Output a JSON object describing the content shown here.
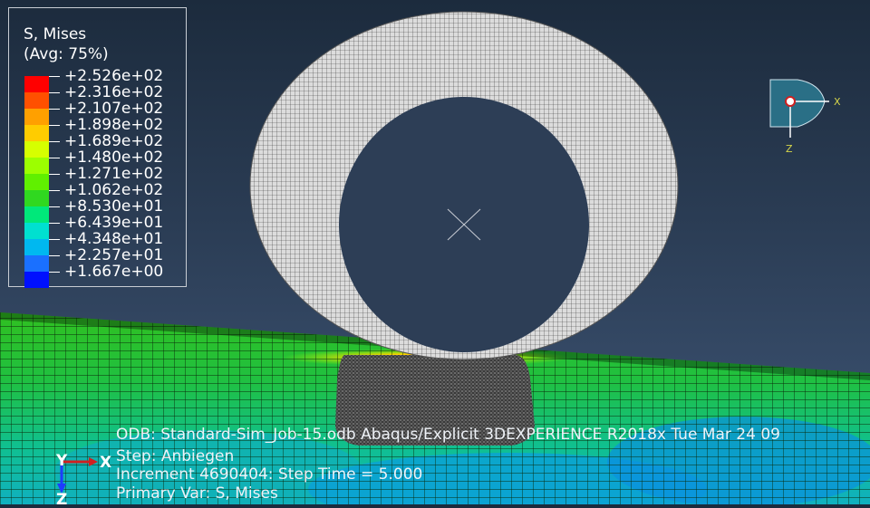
{
  "legend": {
    "title": "S, Mises",
    "subtitle": "(Avg: 75%)",
    "values": [
      "+2.526e+02",
      "+2.316e+02",
      "+2.107e+02",
      "+1.898e+02",
      "+1.689e+02",
      "+1.480e+02",
      "+1.271e+02",
      "+1.062e+02",
      "+8.530e+01",
      "+6.439e+01",
      "+4.348e+01",
      "+2.257e+01",
      "+1.667e+00"
    ],
    "colors": [
      "#ff0000",
      "#ff5000",
      "#ffa000",
      "#ffcc00",
      "#d6ff00",
      "#9cff00",
      "#60f000",
      "#30d820",
      "#00e87a",
      "#00e0d0",
      "#00b8f0",
      "#1a70ff",
      "#0010ff"
    ]
  },
  "info": {
    "odb_line": "ODB: Standard-Sim_Job-15.odb    Abaqus/Explicit 3DEXPERIENCE R2018x    Tue Mar 24 09",
    "step_line": "Step: Anbiegen",
    "increment_line": "Increment   4690404: Step Time =     5.000",
    "primary_var_line": "Primary Var: S, Mises"
  },
  "triad": {
    "x_label": "X",
    "y_label": "Y",
    "z_label": "Z"
  },
  "view_cube": {
    "x_label": "X",
    "z_label": "Z"
  }
}
